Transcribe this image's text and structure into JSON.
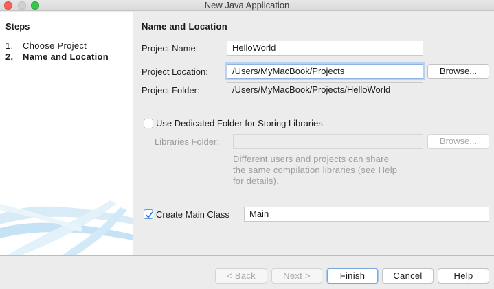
{
  "window": {
    "title": "New Java Application",
    "controls": {
      "close": "close-icon",
      "minimize": "minimize-icon",
      "maximize": "maximize-icon"
    }
  },
  "steps": {
    "title": "Steps",
    "items": [
      {
        "num": "1.",
        "label": "Choose Project",
        "current": false
      },
      {
        "num": "2.",
        "label": "Name and Location",
        "current": true
      }
    ]
  },
  "section": {
    "title": "Name and Location",
    "project_name": {
      "label": "Project Name:",
      "value": "HelloWorld"
    },
    "project_location": {
      "label": "Project Location:",
      "value": "/Users/MyMacBook/Projects",
      "browse": "Browse..."
    },
    "project_folder": {
      "label": "Project Folder:",
      "value": "/Users/MyMacBook/Projects/HelloWorld"
    },
    "dedicated_folder": {
      "label": "Use Dedicated Folder for Storing Libraries",
      "checked": false
    },
    "libraries_folder": {
      "label": "Libraries Folder:",
      "value": "",
      "browse": "Browse...",
      "help": [
        "Different users and projects can share",
        "the same compilation libraries (see Help",
        "for details)."
      ]
    },
    "main_class": {
      "label": "Create Main Class",
      "checked": true,
      "value": "Main"
    }
  },
  "footer": {
    "back": "< Back",
    "next": "Next >",
    "finish": "Finish",
    "cancel": "Cancel",
    "help": "Help"
  },
  "colors": {
    "focus": "#8fb3e0",
    "check": "#2f7de1"
  }
}
